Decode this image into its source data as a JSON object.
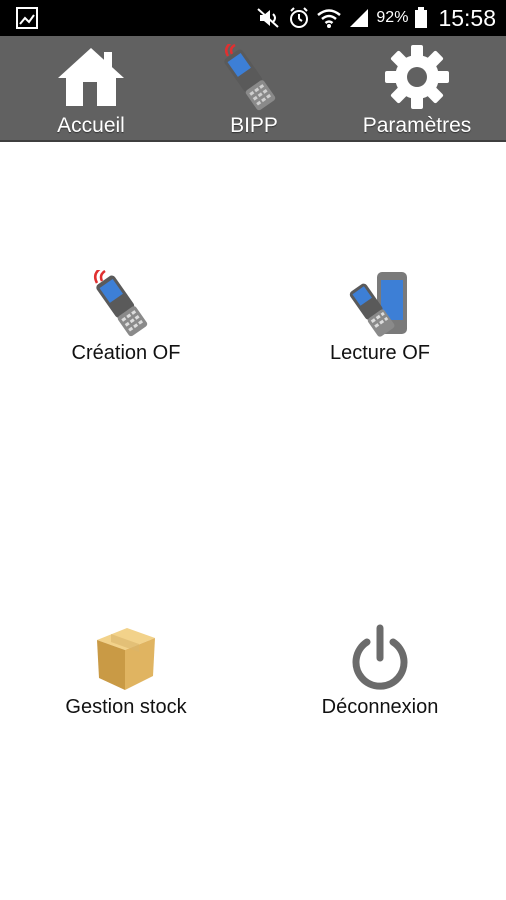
{
  "status_bar": {
    "left_icon": "gallery-icon",
    "battery_percent": "92%",
    "time": "15:58",
    "icons": [
      "mute-icon",
      "alarm-icon",
      "wifi-icon",
      "signal-icon",
      "battery-icon"
    ]
  },
  "nav": {
    "items": [
      {
        "label": "Accueil",
        "icon": "home-icon"
      },
      {
        "label": "BIPP",
        "icon": "scanner-icon"
      },
      {
        "label": "Paramètres",
        "icon": "gear-icon"
      }
    ]
  },
  "menu": {
    "tiles": [
      {
        "label": "Création OF",
        "icon": "scanner-icon"
      },
      {
        "label": "Lecture OF",
        "icon": "phone-scanner-icon"
      },
      {
        "label": "Gestion stock",
        "icon": "box-icon"
      },
      {
        "label": "Déconnexion",
        "icon": "power-icon"
      }
    ]
  },
  "colors": {
    "nav_background": "#616161",
    "status_background": "#000000",
    "screen_blue": "#3d7fd6",
    "signal_red": "#e03030"
  }
}
